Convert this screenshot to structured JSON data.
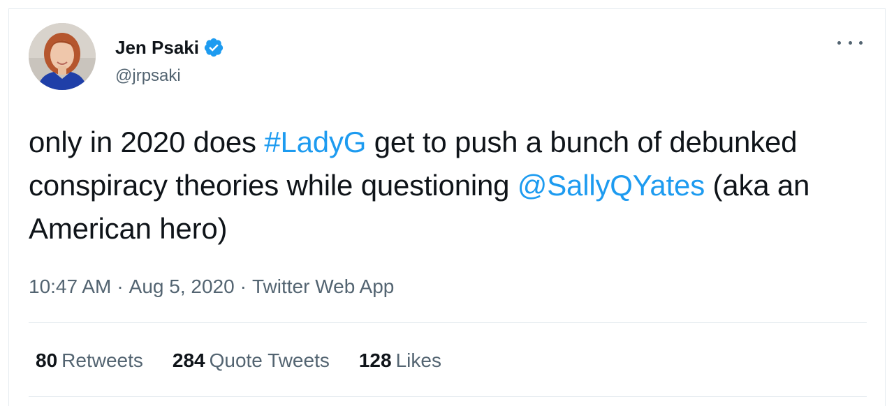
{
  "author": {
    "name": "Jen Psaki",
    "handle": "@jrpsaki",
    "verified": true,
    "avatar_icon": "profile-photo"
  },
  "tweet": {
    "text_before_hashtag": "only in 2020 does ",
    "hashtag": "#LadyG",
    "text_after_hashtag": " get to push a bunch of debunked conspiracy theories while questioning ",
    "mention": "@SallyQYates",
    "text_after_mention": " (aka an American hero)"
  },
  "meta": {
    "time": "10:47 AM",
    "separator": "·",
    "date": "Aug 5, 2020",
    "source": "Twitter Web App"
  },
  "stats": [
    {
      "count": "80",
      "label": "Retweets"
    },
    {
      "count": "284",
      "label": "Quote Tweets"
    },
    {
      "count": "128",
      "label": "Likes"
    }
  ],
  "colors": {
    "link": "#1d9bf0",
    "secondary_text": "#536471",
    "verified_badge": "#1d9bf0"
  },
  "icons": {
    "verified": "verified-badge-icon",
    "more": "more-options-icon"
  }
}
